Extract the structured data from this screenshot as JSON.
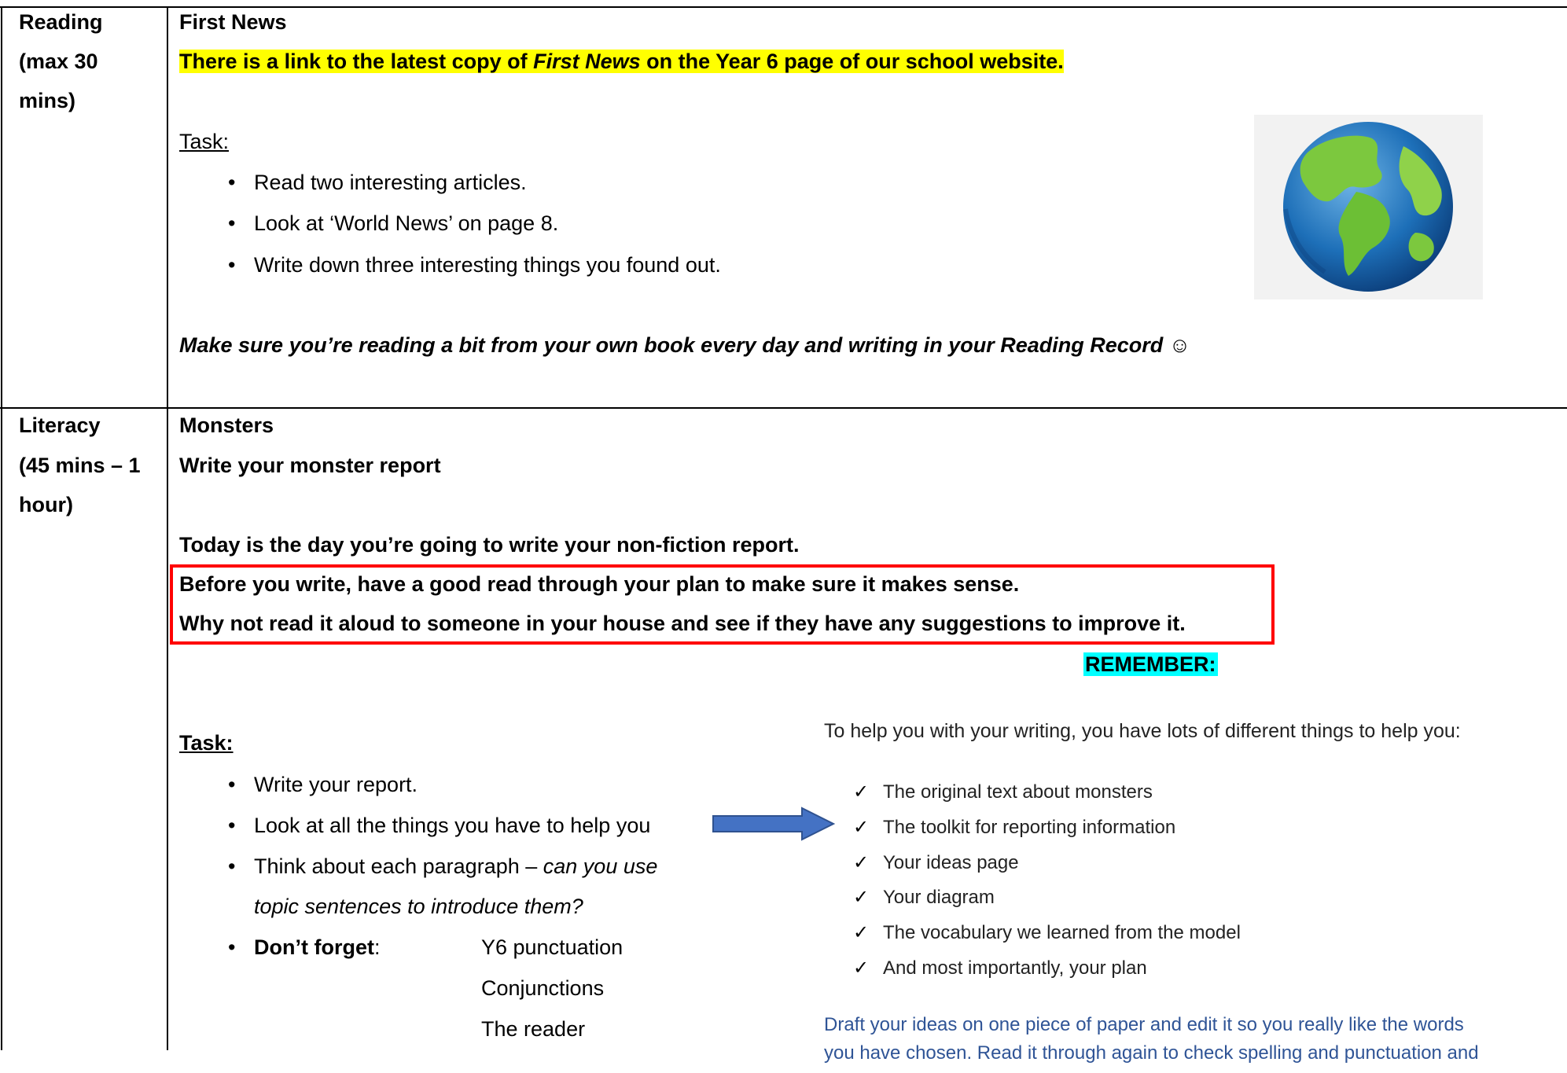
{
  "reading": {
    "label": [
      "Reading",
      "(max 30",
      "mins)"
    ],
    "title": "First News",
    "link_pre": "There is a link to the latest copy of ",
    "link_italic": "First News",
    "link_post": " on the Year 6 page of our school website.",
    "task_label": "Task:",
    "tasks": [
      "Read two interesting articles.",
      "Look at ‘World News’ on page 8.",
      "Write down three interesting things you found out."
    ],
    "reminder": "Make sure you’re reading a bit from your own book every day and writing in your Reading Record ☺"
  },
  "literacy": {
    "label": [
      "Literacy",
      "(45 mins – 1",
      "hour)"
    ],
    "title": "Monsters",
    "subtitle": "Write your monster report",
    "intro": "Today is the day you’re going to write your non-fiction report.",
    "boxed": [
      "Before you write, have a good read through your plan to make sure it makes sense.",
      "Why not read it aloud to someone in your house and see if they have any suggestions to improve it."
    ],
    "remember": "REMEMBER:",
    "task_label": "Task:",
    "tasks": [
      "Write your report.",
      "Look at all the things you have to help you"
    ],
    "task3_pre": " Think about each paragraph – ",
    "task3_italic": "can you use",
    "task3_line2": "topic sentences to introduce them?",
    "dont_forget": "Don’t forget",
    "colon": ":",
    "forget_items": [
      "Y6 punctuation",
      "Conjunctions",
      "The reader"
    ],
    "help_intro": "To help you with your writing, you have lots of different things to help you:",
    "check_mark": "✓",
    "help_items": [
      "The original text about monsters",
      "The toolkit for reporting information",
      "Your ideas page",
      "Your diagram",
      "The vocabulary we learned from the model",
      "And most importantly, your plan"
    ],
    "draft_line1": "Draft your ideas on one piece of paper and edit it so you really like the words",
    "draft_line2": "you have chosen. Read it through again to check spelling and punctuation and"
  },
  "colors": {
    "highlight_yellow": "#ffff00",
    "highlight_cyan": "#00ffff",
    "red_box": "#ff0000",
    "arrow": "#4472c4",
    "draft_text": "#2f5496"
  },
  "icons": {
    "globe": "globe-icon",
    "arrow": "right-arrow-icon"
  }
}
